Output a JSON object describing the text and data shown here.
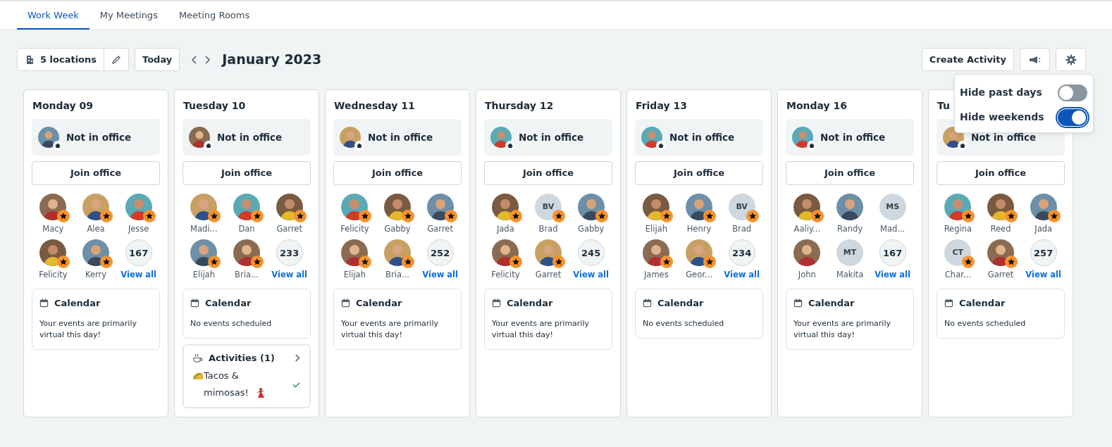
{
  "tabs": [
    {
      "label": "Work Week",
      "selected": true
    },
    {
      "label": "My Meetings",
      "selected": false
    },
    {
      "label": "Meeting Rooms",
      "selected": false
    }
  ],
  "toolbar": {
    "locations": "5 locations",
    "today": "Today",
    "month": "January 2023",
    "create": "Create Activity"
  },
  "settings_menu": [
    {
      "label": "Hide past days",
      "on": false
    },
    {
      "label": "Hide weekends",
      "on": true
    }
  ],
  "days": [
    {
      "title": "Monday 09",
      "status": "Not in office",
      "join": "Join office",
      "people": [
        {
          "name": "Macy",
          "starred": true
        },
        {
          "name": "Alea",
          "starred": true
        },
        {
          "name": "Jesse",
          "starred": true
        },
        {
          "name": "Felicity",
          "starred": true
        },
        {
          "name": "Kerry",
          "starred": true
        }
      ],
      "count": "167",
      "view_all": "View all",
      "calendar": {
        "title": "Calendar",
        "text": "Your events are primarily virtual this day!"
      }
    },
    {
      "title": "Tuesday 10",
      "status": "Not in office",
      "join": "Join office",
      "people": [
        {
          "name": "Madi...",
          "starred": true
        },
        {
          "name": "Dan",
          "starred": true
        },
        {
          "name": "Garret",
          "starred": true
        },
        {
          "name": "Elijah",
          "starred": true
        },
        {
          "name": "Bria...",
          "starred": true
        }
      ],
      "count": "233",
      "view_all": "View all",
      "calendar": {
        "title": "Calendar",
        "text": "No events scheduled"
      },
      "activities": {
        "title": "Activities (1)",
        "items": [
          {
            "text": "Tacos & mimosas!",
            "attending": true
          }
        ]
      }
    },
    {
      "title": "Wednesday 11",
      "status": "Not in office",
      "join": "Join office",
      "people": [
        {
          "name": "Felicity",
          "starred": true
        },
        {
          "name": "Gabby",
          "starred": true
        },
        {
          "name": "Garret",
          "starred": true
        },
        {
          "name": "Elijah",
          "starred": true
        },
        {
          "name": "Bria...",
          "starred": true
        }
      ],
      "count": "252",
      "view_all": "View all",
      "calendar": {
        "title": "Calendar",
        "text": "Your events are primarily virtual this day!"
      }
    },
    {
      "title": "Thursday 12",
      "status": "Not in office",
      "join": "Join office",
      "people": [
        {
          "name": "Jada",
          "starred": true
        },
        {
          "name": "Brad",
          "kind": "initials",
          "initials": "BV",
          "starred": true
        },
        {
          "name": "Gabby",
          "starred": true
        },
        {
          "name": "Felicity",
          "starred": true
        },
        {
          "name": "Garret",
          "starred": true
        }
      ],
      "count": "245",
      "view_all": "View all",
      "calendar": {
        "title": "Calendar",
        "text": "Your events are primarily virtual this day!"
      }
    },
    {
      "title": "Friday 13",
      "status": "Not in office",
      "join": "Join office",
      "people": [
        {
          "name": "Elijah",
          "starred": true
        },
        {
          "name": "Henry",
          "starred": true
        },
        {
          "name": "Brad",
          "kind": "initials",
          "initials": "BV",
          "starred": true
        },
        {
          "name": "James",
          "starred": true
        },
        {
          "name": "Geor...",
          "starred": true
        }
      ],
      "count": "234",
      "view_all": "View all",
      "calendar": {
        "title": "Calendar",
        "text": "No events scheduled"
      }
    },
    {
      "title": "Monday 16",
      "status": "Not in office",
      "join": "Join office",
      "people": [
        {
          "name": "Aaliy...",
          "starred": true
        },
        {
          "name": "Randy",
          "starred": false
        },
        {
          "name": "Mad...",
          "kind": "initials",
          "initials": "MS",
          "starred": false
        },
        {
          "name": "John",
          "starred": false
        },
        {
          "name": "Makita",
          "kind": "initials",
          "initials": "MT",
          "starred": false
        }
      ],
      "count": "167",
      "view_all": "View all",
      "calendar": {
        "title": "Calendar",
        "text": "Your events are primarily virtual this day!"
      }
    },
    {
      "title": "Tu",
      "status": "Not in office",
      "join": "Join office",
      "people": [
        {
          "name": "Regina",
          "starred": true
        },
        {
          "name": "Reed",
          "starred": true
        },
        {
          "name": "Jada",
          "starred": true
        },
        {
          "name": "Char...",
          "kind": "initials",
          "initials": "CT",
          "starred": true
        },
        {
          "name": "Garret",
          "starred": true
        }
      ],
      "count": "257",
      "view_all": "View all",
      "calendar": {
        "title": "Calendar",
        "text": "No events scheduled"
      }
    }
  ]
}
